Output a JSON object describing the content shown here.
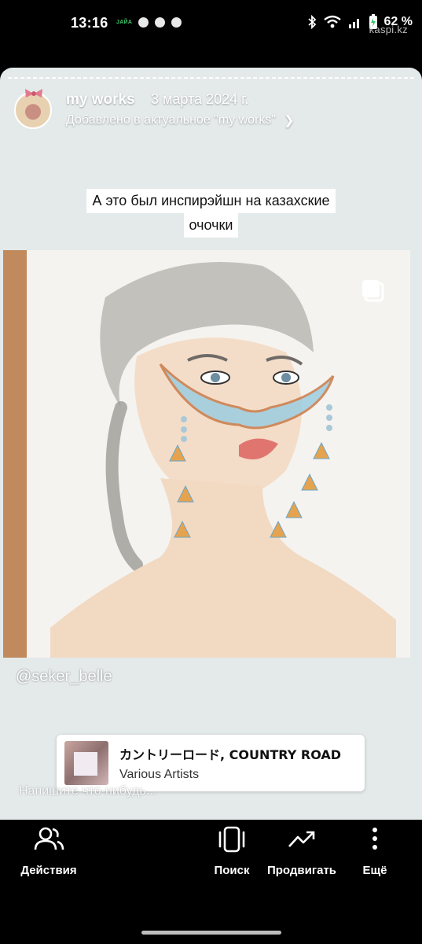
{
  "status_bar": {
    "time": "13:16",
    "carrier_tag": "JAЙA",
    "battery": "62 %",
    "watermark": "kaspi.kz"
  },
  "story": {
    "username": "my works",
    "date": "3 марта 2024 г.",
    "highlight_text": "Добавлено в актуальное \"my works\"",
    "caption_lines": [
      "А это был инспирэйшн на казахские",
      "очочки"
    ],
    "mention": "@seker_belle",
    "music": {
      "title": "カントリーロード, COUNTRY ROAD",
      "artist": "Various Artists"
    },
    "reply_placeholder": "Напишите что-нибудь..."
  },
  "actions": [
    {
      "label": "Действия",
      "icon": "people-icon"
    },
    {
      "label": "Поиск",
      "icon": "phone-frame-icon"
    },
    {
      "label": "Продвигать",
      "icon": "trend-up-icon"
    },
    {
      "label": "Ещё",
      "icon": "more-vertical-icon"
    }
  ],
  "colors": {
    "story_background": "#e4e9ea",
    "bar_background": "#000000",
    "jaiya_green": "#39c46b"
  }
}
